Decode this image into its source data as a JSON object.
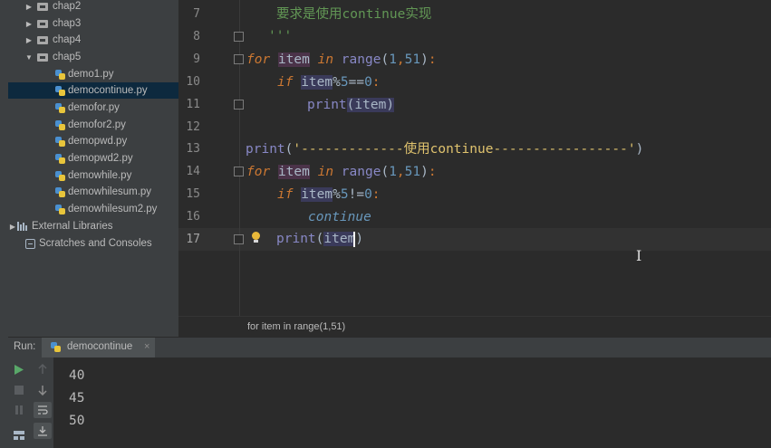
{
  "project_tree": {
    "folders": [
      "chap2",
      "chap3",
      "chap4",
      "chap5"
    ],
    "files": [
      "demo1.py",
      "democontinue.py",
      "demofor.py",
      "demofor2.py",
      "demopwd.py",
      "demopwd2.py",
      "demowhile.py",
      "demowhilesum.py",
      "demowhilesum2.py"
    ],
    "selected_file": "democontinue.py",
    "external_libraries": "External Libraries",
    "scratches": "Scratches and Consoles"
  },
  "editor": {
    "line_numbers": [
      "7",
      "8",
      "9",
      "10",
      "11",
      "12",
      "13",
      "14",
      "15",
      "16",
      "17"
    ],
    "current_line": "17",
    "code": {
      "l7_comment": "要求是使用continue实现",
      "l8_quote": "'''",
      "for_kw": "for",
      "in_kw": "in",
      "if_kw": "if",
      "item": "item",
      "range_fn": "range",
      "print_fn": "print",
      "paren_open": "(",
      "paren_close": ")",
      "comma": ",",
      "colon": ":",
      "num_1": "1",
      "num_51": "51",
      "mod_op": "%",
      "num_5": "5",
      "eq_op": "==",
      "ne_op": "!=",
      "num_0": "0",
      "l13_string": "'-------------使用continue-----------------'",
      "continue_kw": "continue",
      "l17_item_partial": "ite",
      "l17_item_last": "m"
    }
  },
  "breadcrumb": "for item in range(1,51)",
  "run": {
    "label": "Run:",
    "tab_name": "democontinue",
    "close_glyph": "×",
    "output_lines": [
      "40",
      "45",
      "50"
    ]
  },
  "colors": {
    "keyword": "#cc7832",
    "builtin": "#8888c6",
    "number": "#6897bb",
    "string": "#6a8759",
    "run_green": "#59a869"
  },
  "icons": [
    "triangle-right-icon",
    "folder-icon",
    "python-file-icon",
    "library-icon",
    "scratch-icon",
    "lightbulb-icon",
    "play-icon",
    "stop-icon",
    "pause-icon",
    "arrow-up-icon",
    "arrow-down-icon",
    "soft-wrap-icon",
    "scroll-to-end-icon"
  ]
}
